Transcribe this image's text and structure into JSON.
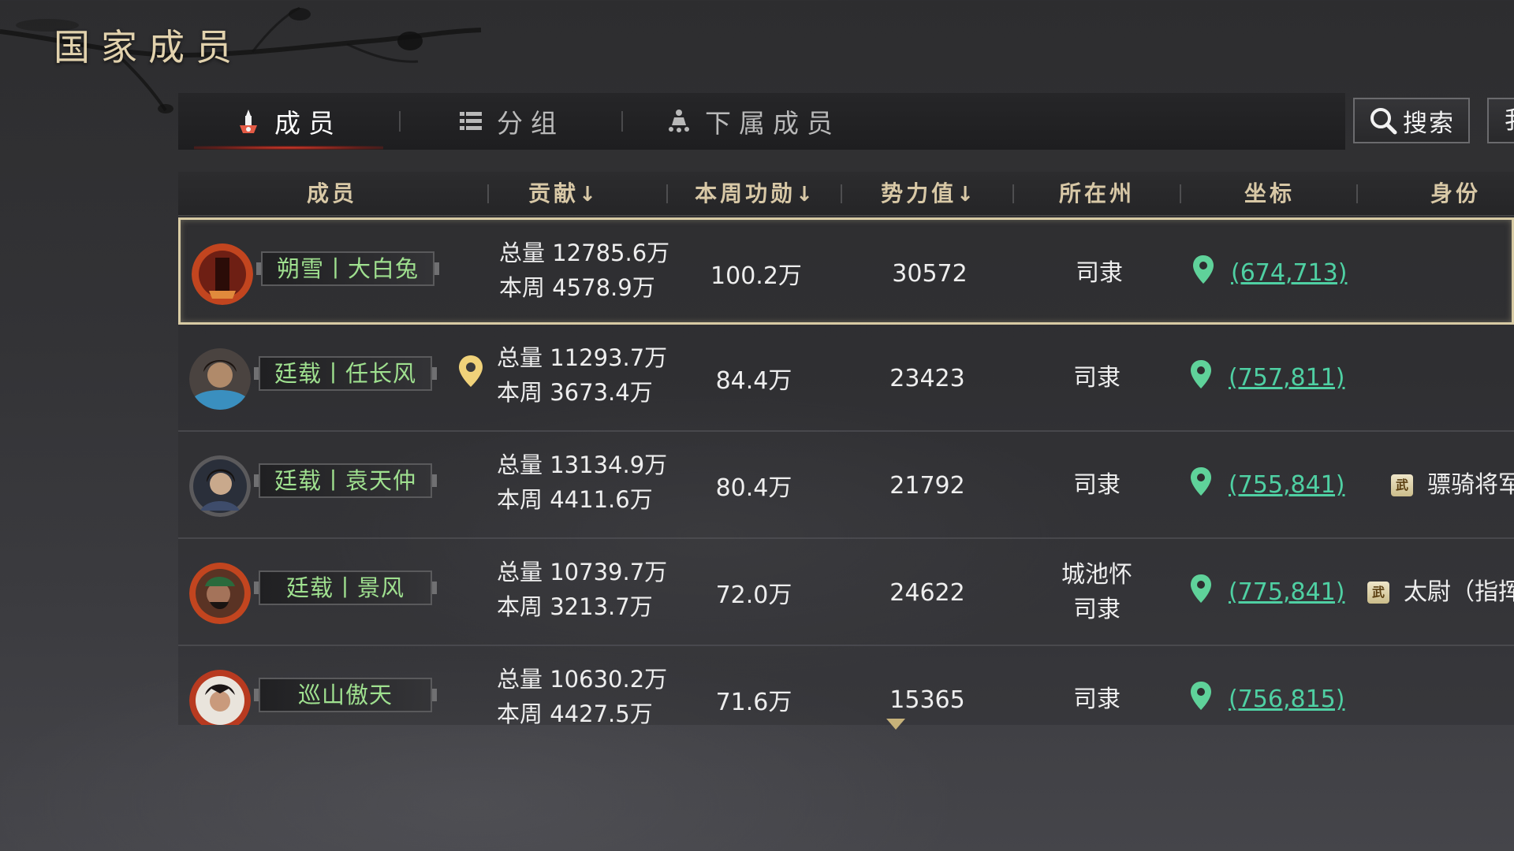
{
  "page_title": "国家成员",
  "tabs": [
    {
      "label": "成员",
      "active": true,
      "icon": "member-icon"
    },
    {
      "label": "分组",
      "active": false,
      "icon": "list-icon"
    },
    {
      "label": "下属成员",
      "active": false,
      "icon": "subordinate-icon"
    }
  ],
  "search_label": "搜索",
  "extra_button_label": "我",
  "columns": {
    "member": "成员",
    "contribution": "贡献",
    "weekly_merit": "本周功勋",
    "power": "势力值",
    "province": "所在州",
    "coords": "坐标",
    "identity": "身份",
    "sort_arrow": "↓"
  },
  "rows": [
    {
      "name": "朔雪丨大白兔",
      "total": "总量 12785.6万",
      "weekly": "本周 4578.9万",
      "merit": "100.2万",
      "power": "30572",
      "province_line1": "司隶",
      "province_line2": "",
      "coords": "(674,713)",
      "badge": "",
      "identity": "",
      "selected": true,
      "has_location_pin": false
    },
    {
      "name": "廷载丨任长风",
      "total": "总量 11293.7万",
      "weekly": "本周 3673.4万",
      "merit": "84.4万",
      "power": "23423",
      "province_line1": "司隶",
      "province_line2": "",
      "coords": "(757,811)",
      "badge": "",
      "identity": "",
      "selected": false,
      "has_location_pin": true
    },
    {
      "name": "廷载丨袁天仲",
      "total": "总量 13134.9万",
      "weekly": "本周 4411.6万",
      "merit": "80.4万",
      "power": "21792",
      "province_line1": "司隶",
      "province_line2": "",
      "coords": "(755,841)",
      "badge": "武",
      "identity": "骠骑将军",
      "selected": false,
      "has_location_pin": false
    },
    {
      "name": "廷载丨景风",
      "total": "总量 10739.7万",
      "weekly": "本周 3213.7万",
      "merit": "72.0万",
      "power": "24622",
      "province_line1": "城池怀",
      "province_line2": "司隶",
      "coords": "(775,841)",
      "badge": "武",
      "identity": "太尉（指挥",
      "selected": false,
      "has_location_pin": false
    },
    {
      "name": "巡山傲天",
      "total": "总量 10630.2万",
      "weekly": "本周 4427.5万",
      "merit": "71.6万",
      "power": "15365",
      "province_line1": "司隶",
      "province_line2": "",
      "coords": "(756,815)",
      "badge": "",
      "identity": "",
      "selected": false,
      "has_location_pin": false
    }
  ],
  "colors": {
    "accent_gold": "#d8c8a6",
    "name_green": "#9fe08f",
    "coord_teal": "#4fd0a3",
    "tab_active_red": "#d73a2a",
    "selected_border": "#d8cba4"
  }
}
